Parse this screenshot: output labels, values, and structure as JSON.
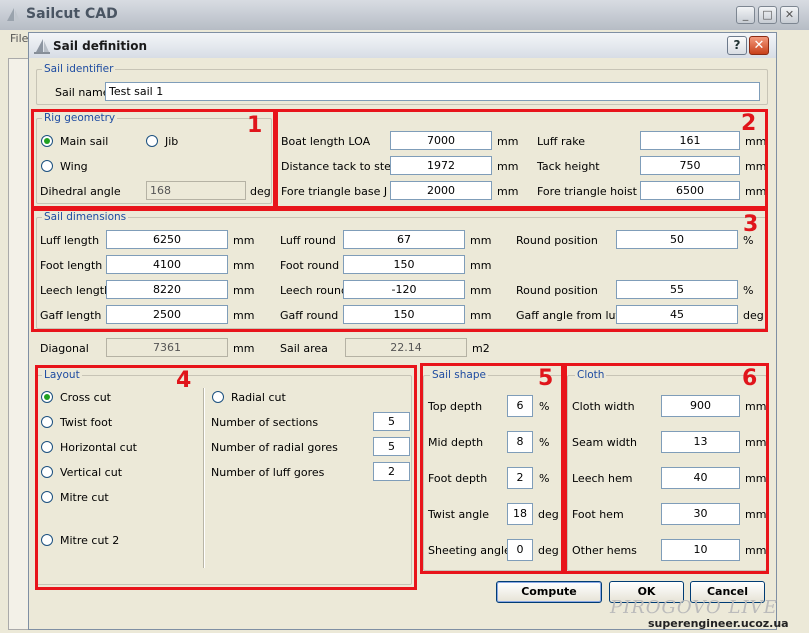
{
  "app": {
    "title": "Sailcut CAD",
    "menu_first": "File"
  },
  "dialog": {
    "title": "Sail definition",
    "help_label": "?",
    "close_label": "✕"
  },
  "sail_identifier": {
    "group_title": "Sail identifier",
    "name_label": "Sail name",
    "name_value": "Test sail 1"
  },
  "rig_geometry": {
    "group_title": "Rig geometry",
    "main_sail": "Main sail",
    "jib": "Jib",
    "wing": "Wing",
    "selected": "main_sail",
    "dihedral_label": "Dihedral angle",
    "dihedral_value": "168",
    "dihedral_unit": "deg"
  },
  "rig_params": {
    "boat_length_label": "Boat length LOA",
    "boat_length_value": "7000",
    "boat_length_unit": "mm",
    "tack_label": "Distance tack to stem",
    "tack_value": "1972",
    "tack_unit": "mm",
    "fore_base_label": "Fore triangle base  J",
    "fore_base_value": "2000",
    "fore_base_unit": "mm",
    "luff_rake_label": "Luff rake",
    "luff_rake_value": "161",
    "luff_rake_unit": "mm",
    "tack_height_label": "Tack height",
    "tack_height_value": "750",
    "tack_height_unit": "mm",
    "fore_hoist_label": "Fore triangle hoist  I",
    "fore_hoist_value": "6500",
    "fore_hoist_unit": "mm"
  },
  "sail_dimensions": {
    "group_title": "Sail dimensions",
    "luff_length_label": "Luff length",
    "luff_length_value": "6250",
    "luff_length_unit": "mm",
    "foot_length_label": "Foot length",
    "foot_length_value": "4100",
    "foot_length_unit": "mm",
    "leech_length_label": "Leech length",
    "leech_length_value": "8220",
    "leech_length_unit": "mm",
    "gaff_length_label": "Gaff length",
    "gaff_length_value": "2500",
    "gaff_length_unit": "mm",
    "luff_round_label": "Luff round",
    "luff_round_value": "67",
    "luff_round_unit": "mm",
    "foot_round_label": "Foot round",
    "foot_round_value": "150",
    "foot_round_unit": "mm",
    "leech_round_label": "Leech round",
    "leech_round_value": "-120",
    "leech_round_unit": "mm",
    "gaff_round_label": "Gaff round",
    "gaff_round_value": "150",
    "gaff_round_unit": "mm",
    "round_pos1_label": "Round position",
    "round_pos1_value": "50",
    "round_pos1_unit": "%",
    "round_pos2_label": "Round position",
    "round_pos2_value": "55",
    "round_pos2_unit": "%",
    "gaff_angle_label": "Gaff angle from luff",
    "gaff_angle_value": "45",
    "gaff_angle_unit": "deg"
  },
  "summary": {
    "diagonal_label": "Diagonal",
    "diagonal_value": "7361",
    "diagonal_unit": "mm",
    "area_label": "Sail area",
    "area_value": "22.14",
    "area_unit": "m2"
  },
  "layout": {
    "group_title": "Layout",
    "cross_cut": "Cross cut",
    "twist_foot": "Twist foot",
    "horizontal_cut": "Horizontal cut",
    "vertical_cut": "Vertical cut",
    "mitre_cut": "Mitre cut",
    "mitre_cut_2": "Mitre cut 2",
    "radial_cut": "Radial cut",
    "selected": "cross_cut",
    "sections_label": "Number of sections",
    "sections_value": "5",
    "radial_gores_label": "Number of radial gores",
    "radial_gores_value": "5",
    "luff_gores_label": "Number of luff gores",
    "luff_gores_value": "2"
  },
  "sail_shape": {
    "group_title": "Sail shape",
    "top_depth_label": "Top depth",
    "top_depth_value": "6",
    "top_depth_unit": "%",
    "mid_depth_label": "Mid depth",
    "mid_depth_value": "8",
    "mid_depth_unit": "%",
    "foot_depth_label": "Foot depth",
    "foot_depth_value": "2",
    "foot_depth_unit": "%",
    "twist_label": "Twist angle",
    "twist_value": "18",
    "twist_unit": "deg",
    "sheeting_label": "Sheeting angle",
    "sheeting_value": "0",
    "sheeting_unit": "deg"
  },
  "cloth": {
    "group_title": "Cloth",
    "cloth_width_label": "Cloth width",
    "cloth_width_value": "900",
    "cloth_width_unit": "mm",
    "seam_width_label": "Seam width",
    "seam_width_value": "13",
    "seam_width_unit": "mm",
    "leech_hem_label": "Leech hem",
    "leech_hem_value": "40",
    "leech_hem_unit": "mm",
    "foot_hem_label": "Foot hem",
    "foot_hem_value": "30",
    "foot_hem_unit": "mm",
    "other_hems_label": "Other hems",
    "other_hems_value": "10",
    "other_hems_unit": "mm"
  },
  "buttons": {
    "compute": "Compute",
    "ok": "OK",
    "cancel": "Cancel"
  },
  "callouts": [
    "1",
    "2",
    "3",
    "4",
    "5",
    "6"
  ],
  "watermark": {
    "brand": "PIROGOVO LIVE",
    "site": "superengineer.ucoz.ua"
  },
  "colors": {
    "callout": "#e8141b",
    "group_title": "#1e4ca1",
    "dialog_bg": "#ece9d8"
  }
}
